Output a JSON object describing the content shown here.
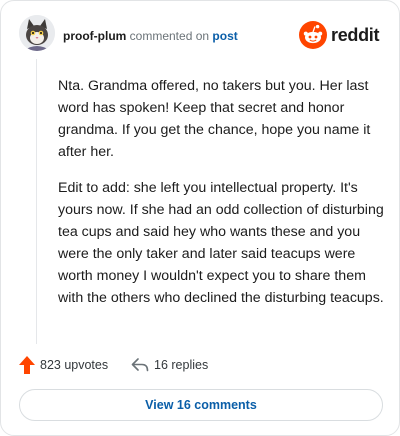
{
  "colors": {
    "upvote": "#ff4500",
    "link": "#0a5ea8",
    "brand": "#ff4500"
  },
  "header": {
    "username": "proof-plum",
    "verb": "commented on",
    "post_link": "post",
    "logo_text": "reddit",
    "avatar_icon": "cat-avatar-icon"
  },
  "comment": {
    "paragraphs": [
      "Nta. Grandma offered, no takers but you. Her last word has spoken! Keep that secret and honor grandma. If you get the chance, hope you name it after her.",
      "Edit to add: she left you intellectual property. It's yours now. If she had an odd collection of disturbing tea cups and said hey who wants these and you were the only taker and later said teacups were worth money I wouldn't expect you to share them with the others who declined the disturbing teacups."
    ]
  },
  "actions": {
    "upvotes": "823 upvotes",
    "replies": "16 replies",
    "upvote_icon": "upvote-arrow-icon",
    "reply_icon": "reply-arrow-icon"
  },
  "view_button": "View 16 comments"
}
